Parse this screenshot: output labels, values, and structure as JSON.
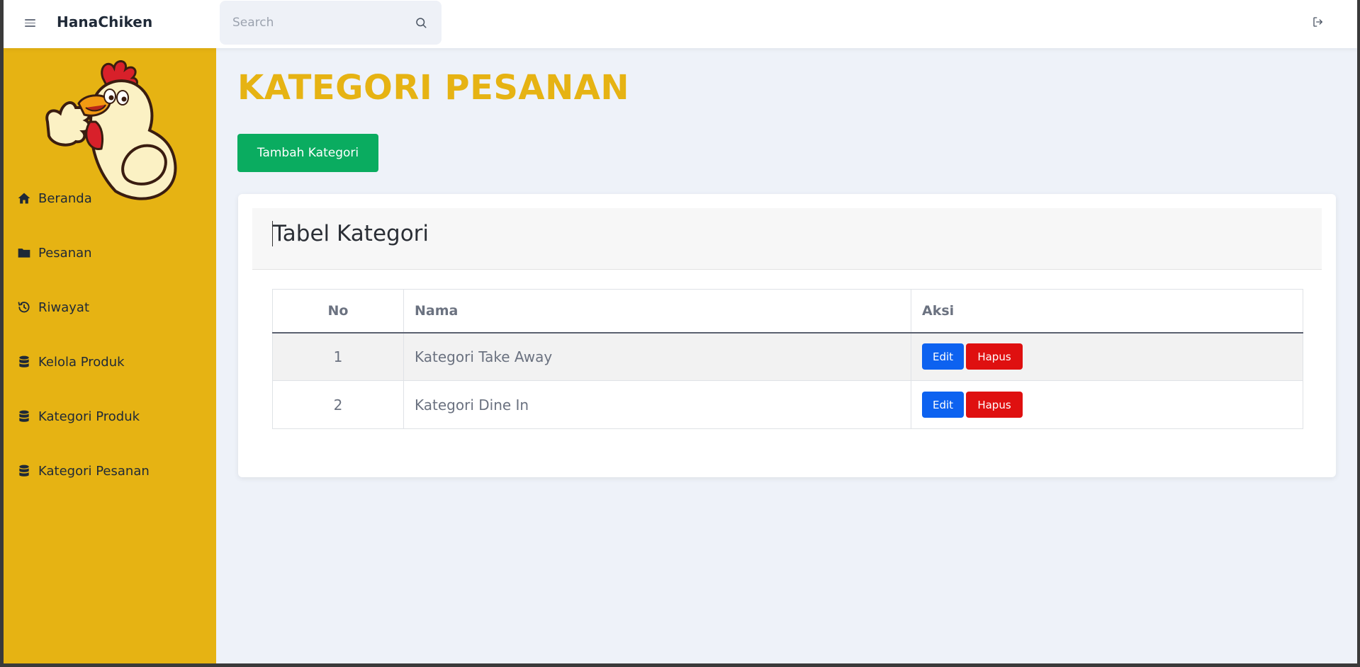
{
  "app": {
    "brand": "HanaChiken"
  },
  "search": {
    "placeholder": "Search"
  },
  "sidebar": {
    "items": [
      {
        "label": "Beranda",
        "icon": "home-icon"
      },
      {
        "label": "Pesanan",
        "icon": "folder-icon"
      },
      {
        "label": "Riwayat",
        "icon": "history-icon"
      },
      {
        "label": "Kelola Produk",
        "icon": "database-icon"
      },
      {
        "label": "Kategori Produk",
        "icon": "database-icon"
      },
      {
        "label": "Kategori Pesanan",
        "icon": "database-icon"
      }
    ]
  },
  "main": {
    "title": "KATEGORI PESANAN",
    "add_button": "Tambah Kategori",
    "card_title": "Tabel Kategori",
    "table": {
      "headers": [
        "No",
        "Nama",
        "Aksi"
      ],
      "rows": [
        {
          "no": "1",
          "nama": "Kategori Take Away",
          "edit": "Edit",
          "hapus": "Hapus"
        },
        {
          "no": "2",
          "nama": "Kategori Dine In",
          "edit": "Edit",
          "hapus": "Hapus"
        }
      ]
    }
  },
  "colors": {
    "accent": "#e6b313",
    "success": "#0aac60",
    "primary": "#0d62f0",
    "danger": "#df1010"
  }
}
